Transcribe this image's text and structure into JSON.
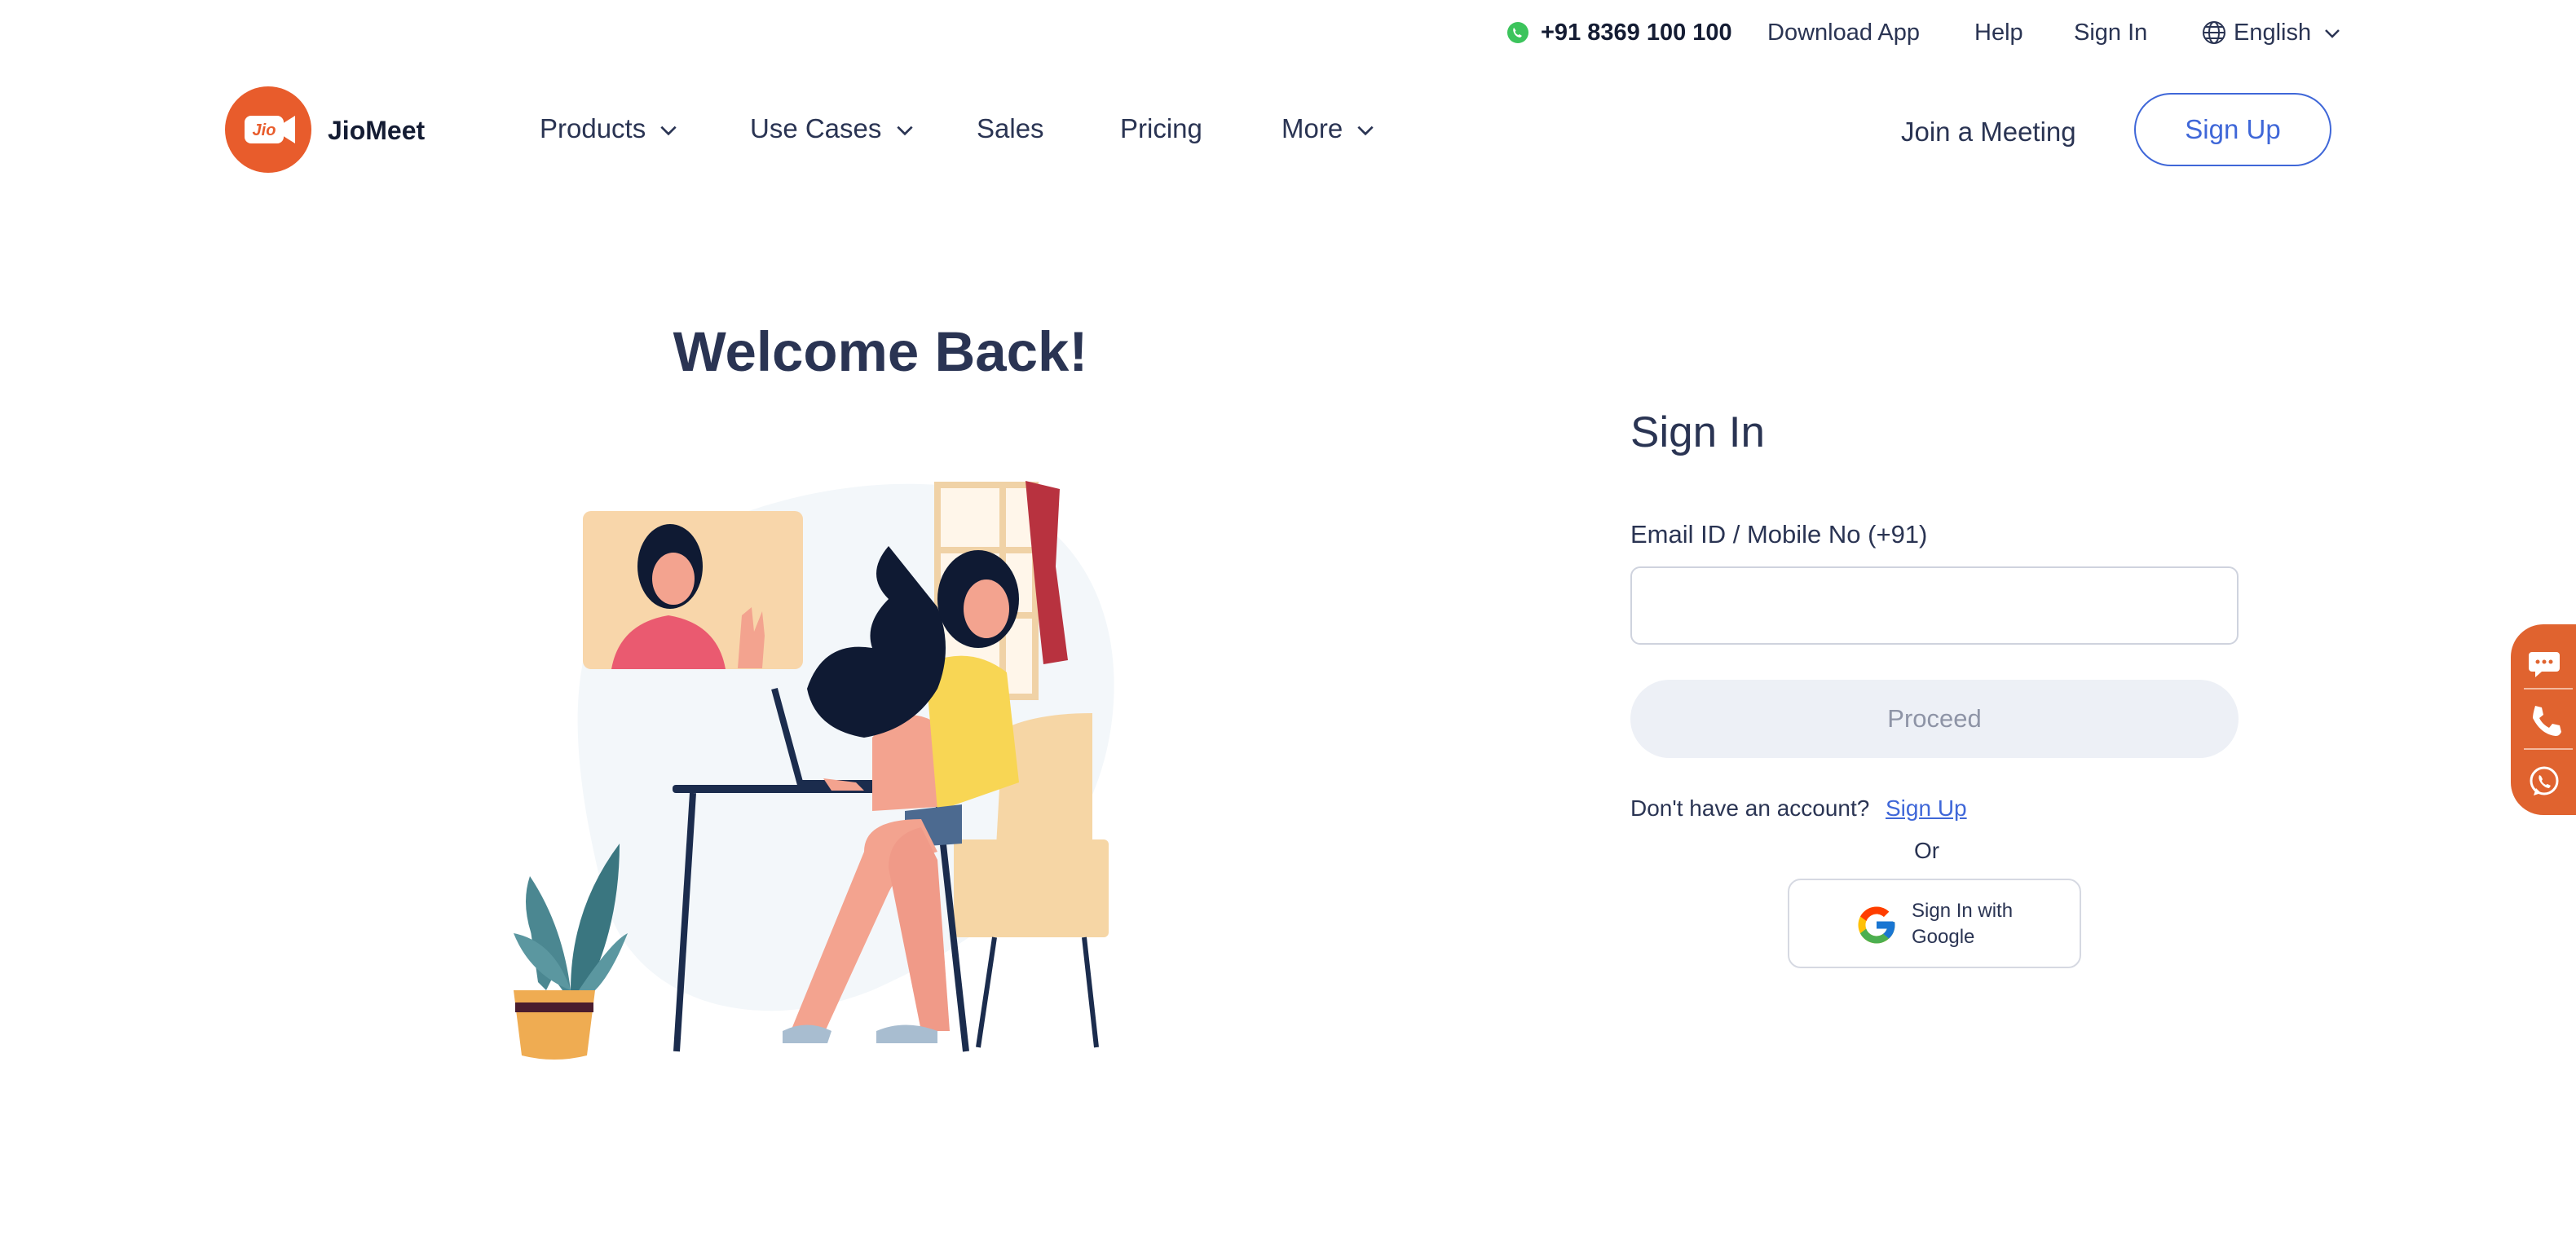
{
  "topbar": {
    "phone": "+91 8369 100 100",
    "download_app": "Download App",
    "help": "Help",
    "sign_in": "Sign In",
    "language": "English"
  },
  "header": {
    "logo_text": "Jio",
    "brand": "JioMeet",
    "nav": [
      "Products",
      "Use Cases",
      "Sales",
      "Pricing",
      "More"
    ],
    "join_meeting": "Join a Meeting",
    "sign_up": "Sign Up"
  },
  "hero": {
    "title": "Welcome Back!"
  },
  "signin": {
    "title": "Sign In",
    "email_label": "Email ID / Mobile No (+91)",
    "email_value": "",
    "email_placeholder": "",
    "proceed": "Proceed",
    "no_account": "Don't have an account?",
    "signup_link": "Sign Up",
    "or": "Or",
    "google_label": "Sign In with Google"
  },
  "side_widget": {
    "icons": [
      "chat-icon",
      "phone-icon",
      "whatsapp-icon"
    ]
  },
  "colors": {
    "brand_orange": "#e85c2c",
    "accent_blue": "#3f67d8",
    "text_dark": "#2a3453",
    "button_disabled_bg": "#edf0f6"
  }
}
